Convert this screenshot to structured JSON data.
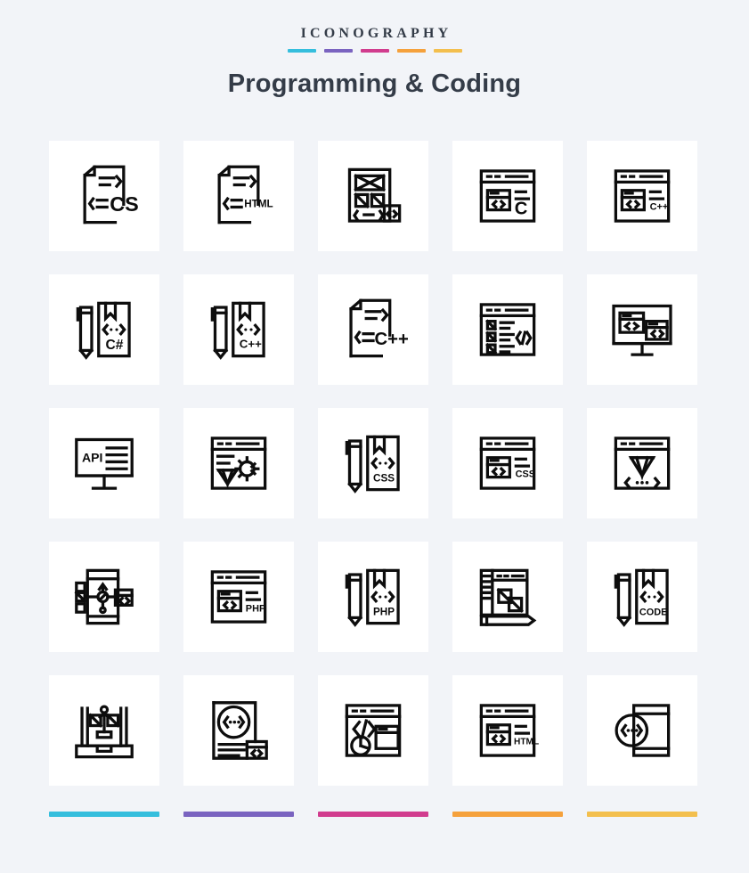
{
  "header": {
    "eyebrow": "ICONOGRAPHY",
    "title": "Programming & Coding"
  },
  "palette": {
    "accent_1": "#35bedd",
    "accent_2": "#7a63c0",
    "accent_3": "#d13c8e",
    "accent_4": "#f5a13c",
    "accent_5": "#f3bf4e",
    "background": "#f2f4f8",
    "card_background": "#ffffff",
    "icon_stroke": "#0d0d0d",
    "title_color": "#343c48"
  },
  "accent_bars": [
    {
      "name": "bar-cyan",
      "color": "#35bedd"
    },
    {
      "name": "bar-purple",
      "color": "#7a63c0"
    },
    {
      "name": "bar-pink",
      "color": "#d13c8e"
    },
    {
      "name": "bar-orange",
      "color": "#f5a13c"
    },
    {
      "name": "bar-yellow",
      "color": "#f3bf4e"
    }
  ],
  "grid": {
    "columns": 5,
    "rows": 5,
    "count": 25,
    "icons": [
      {
        "id": "icon-1",
        "name": "css-file-icon",
        "label": "CSS",
        "row": 1,
        "col": 1
      },
      {
        "id": "icon-2",
        "name": "html-file-icon",
        "label": "HTML",
        "row": 1,
        "col": 2
      },
      {
        "id": "icon-3",
        "name": "wireframe-layout-icon",
        "label": "",
        "row": 1,
        "col": 3
      },
      {
        "id": "icon-4",
        "name": "browser-c-icon",
        "label": "C",
        "row": 1,
        "col": 4
      },
      {
        "id": "icon-5",
        "name": "browser-cpp-icon",
        "label": "C++",
        "row": 1,
        "col": 5
      },
      {
        "id": "icon-6",
        "name": "pencil-book-csharp-icon",
        "label": "C#",
        "row": 2,
        "col": 1
      },
      {
        "id": "icon-7",
        "name": "pencil-book-cpp-icon",
        "label": "C++",
        "row": 2,
        "col": 2
      },
      {
        "id": "icon-8",
        "name": "cpp-file-icon",
        "label": "C++",
        "row": 2,
        "col": 3
      },
      {
        "id": "icon-9",
        "name": "browser-checklist-code-icon",
        "label": "",
        "row": 2,
        "col": 4
      },
      {
        "id": "icon-10",
        "name": "monitor-code-windows-icon",
        "label": "",
        "row": 2,
        "col": 5
      },
      {
        "id": "icon-11",
        "name": "api-monitor-icon",
        "label": "API",
        "row": 3,
        "col": 1
      },
      {
        "id": "icon-12",
        "name": "browser-diamond-gear-icon",
        "label": "",
        "row": 3,
        "col": 2
      },
      {
        "id": "icon-13",
        "name": "pencil-book-css-icon",
        "label": "CSS",
        "row": 3,
        "col": 3
      },
      {
        "id": "icon-14",
        "name": "browser-css-icon",
        "label": "CSS",
        "row": 3,
        "col": 4
      },
      {
        "id": "icon-15",
        "name": "browser-diamond-code-icon",
        "label": "",
        "row": 3,
        "col": 5
      },
      {
        "id": "icon-16",
        "name": "mobile-prototype-icon",
        "label": "",
        "row": 4,
        "col": 1
      },
      {
        "id": "icon-17",
        "name": "browser-php-icon",
        "label": "PHP",
        "row": 4,
        "col": 2
      },
      {
        "id": "icon-18",
        "name": "pencil-book-php-icon",
        "label": "PHP",
        "row": 4,
        "col": 3
      },
      {
        "id": "icon-19",
        "name": "web-design-pencil-icon",
        "label": "",
        "row": 4,
        "col": 4
      },
      {
        "id": "icon-20",
        "name": "pencil-book-code-icon",
        "label": "CODE",
        "row": 4,
        "col": 5
      },
      {
        "id": "icon-21",
        "name": "prototype-board-icon",
        "label": "",
        "row": 5,
        "col": 1
      },
      {
        "id": "icon-22",
        "name": "document-code-circle-icon",
        "label": "",
        "row": 5,
        "col": 2
      },
      {
        "id": "icon-23",
        "name": "browser-chart-code-icon",
        "label": "",
        "row": 5,
        "col": 3
      },
      {
        "id": "icon-24",
        "name": "browser-html-icon",
        "label": "HTML",
        "row": 5,
        "col": 4
      },
      {
        "id": "icon-25",
        "name": "mobile-code-circle-icon",
        "label": "",
        "row": 5,
        "col": 5
      }
    ]
  }
}
